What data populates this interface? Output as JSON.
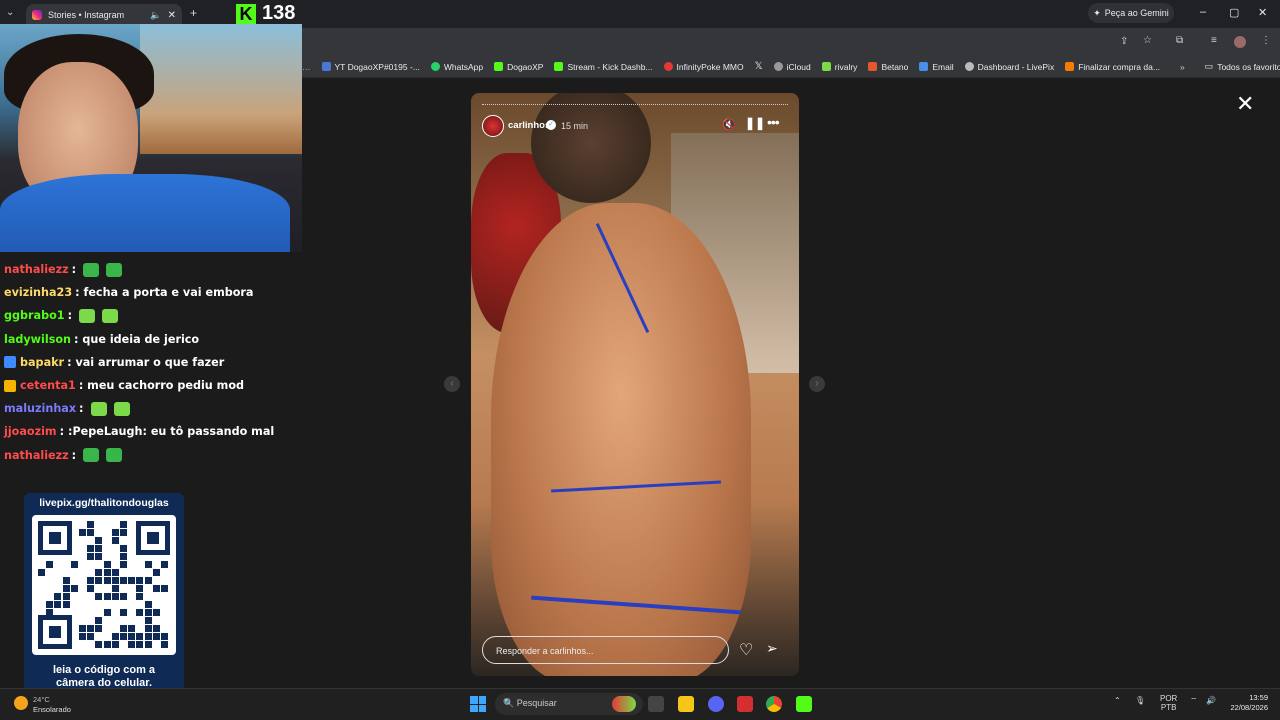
{
  "browser": {
    "tab_title": "Stories • Instagram",
    "gemini_label": "Peça ao Gemini",
    "bookmarks": [
      {
        "label": "YT DogaoXP#0195 -...",
        "color": "#4a77d4"
      },
      {
        "label": "WhatsApp",
        "color": "#25d366"
      },
      {
        "label": "DogaoXP",
        "color": "#53fc18"
      },
      {
        "label": "Stream - Kick Dashb...",
        "color": "#53fc18"
      },
      {
        "label": "InfinityPoke MMO",
        "color": "#e53935"
      },
      {
        "label": "",
        "color": "#000000"
      },
      {
        "label": "iCloud",
        "color": "#999999"
      },
      {
        "label": "rivalry",
        "color": "#7bd94a"
      },
      {
        "label": "Betano",
        "color": "#e4572e"
      },
      {
        "label": "Email",
        "color": "#4a8fe7"
      },
      {
        "label": "Dashboard - LivePix",
        "color": "#bbbbbb"
      },
      {
        "label": "Finalizar compra da...",
        "color": "#f57c00"
      }
    ],
    "favorites_label": "Todos os favoritos"
  },
  "story": {
    "username": "carlinhos",
    "time": "15 min",
    "reply_placeholder": "Responder a carlinhos..."
  },
  "stream": {
    "viewer_count": "138",
    "chat": [
      {
        "user": "nathaliezz",
        "color": "#ff4b4b",
        "text": ":",
        "emotes": 2,
        "badge": ""
      },
      {
        "user": "evizinha23",
        "color": "#ffd966",
        "text": ": fecha a porta e vai embora",
        "emotes": 0,
        "badge": ""
      },
      {
        "user": "ggbrabo1",
        "color": "#53fc18",
        "text": ":",
        "emotes": 2,
        "badge": ""
      },
      {
        "user": "ladywilson",
        "color": "#53fc18",
        "text": ": que ideia de jerico",
        "emotes": 0,
        "badge": ""
      },
      {
        "user": "bapakr",
        "color": "#ffd966",
        "text": ": vai arrumar o que fazer",
        "emotes": 0,
        "badge": "#3d8bff"
      },
      {
        "user": "cetenta1",
        "color": "#ff4b4b",
        "text": ": meu cachorro pediu mod",
        "emotes": 0,
        "badge": "#f5b400"
      },
      {
        "user": "maluzinhax",
        "color": "#7b7bff",
        "text": ":",
        "emotes": 2,
        "badge": ""
      },
      {
        "user": "jjoaozim",
        "color": "#ff4b4b",
        "text": ": :PepeLaugh: eu tô passando mal",
        "emotes": 0,
        "badge": ""
      },
      {
        "user": "nathaliezz",
        "color": "#ff4b4b",
        "text": ":",
        "emotes": 2,
        "badge": ""
      }
    ],
    "qr_top": "livepix.gg/thalitondouglas",
    "qr_bottom_1": "leia o código com a",
    "qr_bottom_2": "câmera do celular."
  },
  "taskbar": {
    "weather_temp": "24°C",
    "weather_text": "Ensolarado",
    "search_placeholder": "Pesquisar",
    "lang_1": "POR",
    "lang_2": "PTB",
    "time": "13:59",
    "date": "22/08/2026"
  }
}
